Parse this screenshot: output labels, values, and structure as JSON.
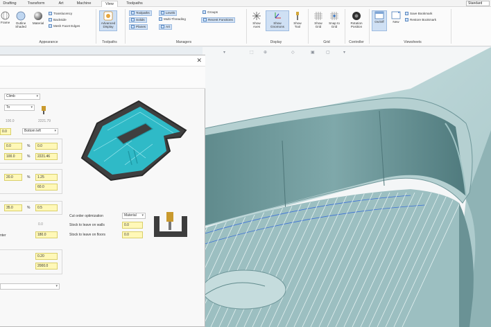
{
  "tabs": [
    {
      "label": "Drafting",
      "active": false
    },
    {
      "label": "Transform",
      "active": false
    },
    {
      "label": "Art",
      "active": false
    },
    {
      "label": "Machine",
      "active": false
    },
    {
      "label": "View",
      "active": true
    },
    {
      "label": "Toolpaths",
      "active": false
    }
  ],
  "style_select": "Standard",
  "ribbon": {
    "appearance": {
      "label": "Appearance",
      "buttons": [
        {
          "label": "Frame"
        },
        {
          "label": "Outline Shaded"
        },
        {
          "label": "Material"
        }
      ],
      "small": [
        "Translucency",
        "Backside",
        "Mesh Facet Edges"
      ]
    },
    "toolpaths": {
      "label": "Toolpaths",
      "buttons": [
        {
          "label": "Advanced Display"
        }
      ]
    },
    "managers": {
      "label": "Managers",
      "small": [
        "Toolpaths",
        "Solids",
        "Planes",
        "Levels",
        "Multi-Threading",
        "Art",
        "Groups",
        "Recent Functions"
      ]
    },
    "display": {
      "label": "Display",
      "buttons": [
        {
          "label": "Show Axes"
        },
        {
          "label": "Show Gnomons"
        },
        {
          "label": "Show Tool"
        }
      ]
    },
    "grid": {
      "label": "Grid",
      "buttons": [
        {
          "label": "Show Grid"
        },
        {
          "label": "Snap to Grid"
        }
      ]
    },
    "controller": {
      "label": "Controller",
      "buttons": [
        {
          "label": "Rotation Position"
        }
      ]
    },
    "viewsheets": {
      "label": "Viewsheets",
      "buttons": [
        {
          "label": "On/Off"
        },
        {
          "label": "New"
        }
      ],
      "small": [
        "Save Bookmark",
        "Restore Bookmark"
      ]
    }
  },
  "dialog": {
    "top_dropdown": "Climb",
    "second_dropdown": "To",
    "greyed": [
      "100.0",
      "2221.79"
    ],
    "row3_value": "0.0",
    "row3_dropdown": "Bottom left",
    "fields": [
      {
        "value": "0.0",
        "unit": "%",
        "value2": "0.0"
      },
      {
        "value": "100.0",
        "unit": "%",
        "value2": "2221.46"
      },
      {
        "value": "20.0",
        "unit": "%",
        "value2": "1.25"
      },
      {
        "value2": "60.0"
      },
      {
        "value": "35.0",
        "unit": "%",
        "value2": "0.5"
      }
    ],
    "greyed2": "0.0",
    "extra_label": "nter",
    "field_180": "180.0",
    "field_020": "0.20",
    "field_2000": "2000.0",
    "bottom_dropdown": "",
    "cut_order_label": "Cut order optimization",
    "cut_order_value": "Material",
    "stock_walls_label": "Stock to leave on walls",
    "stock_walls_value": "0.0",
    "stock_floors_label": "Stock to leave on floors",
    "stock_floors_value": "0.0"
  },
  "colors": {
    "toolpath": "#2ec8d6",
    "part": "#b9d5d6",
    "selected": "#cfe0f4",
    "input": "#fff8b8"
  }
}
